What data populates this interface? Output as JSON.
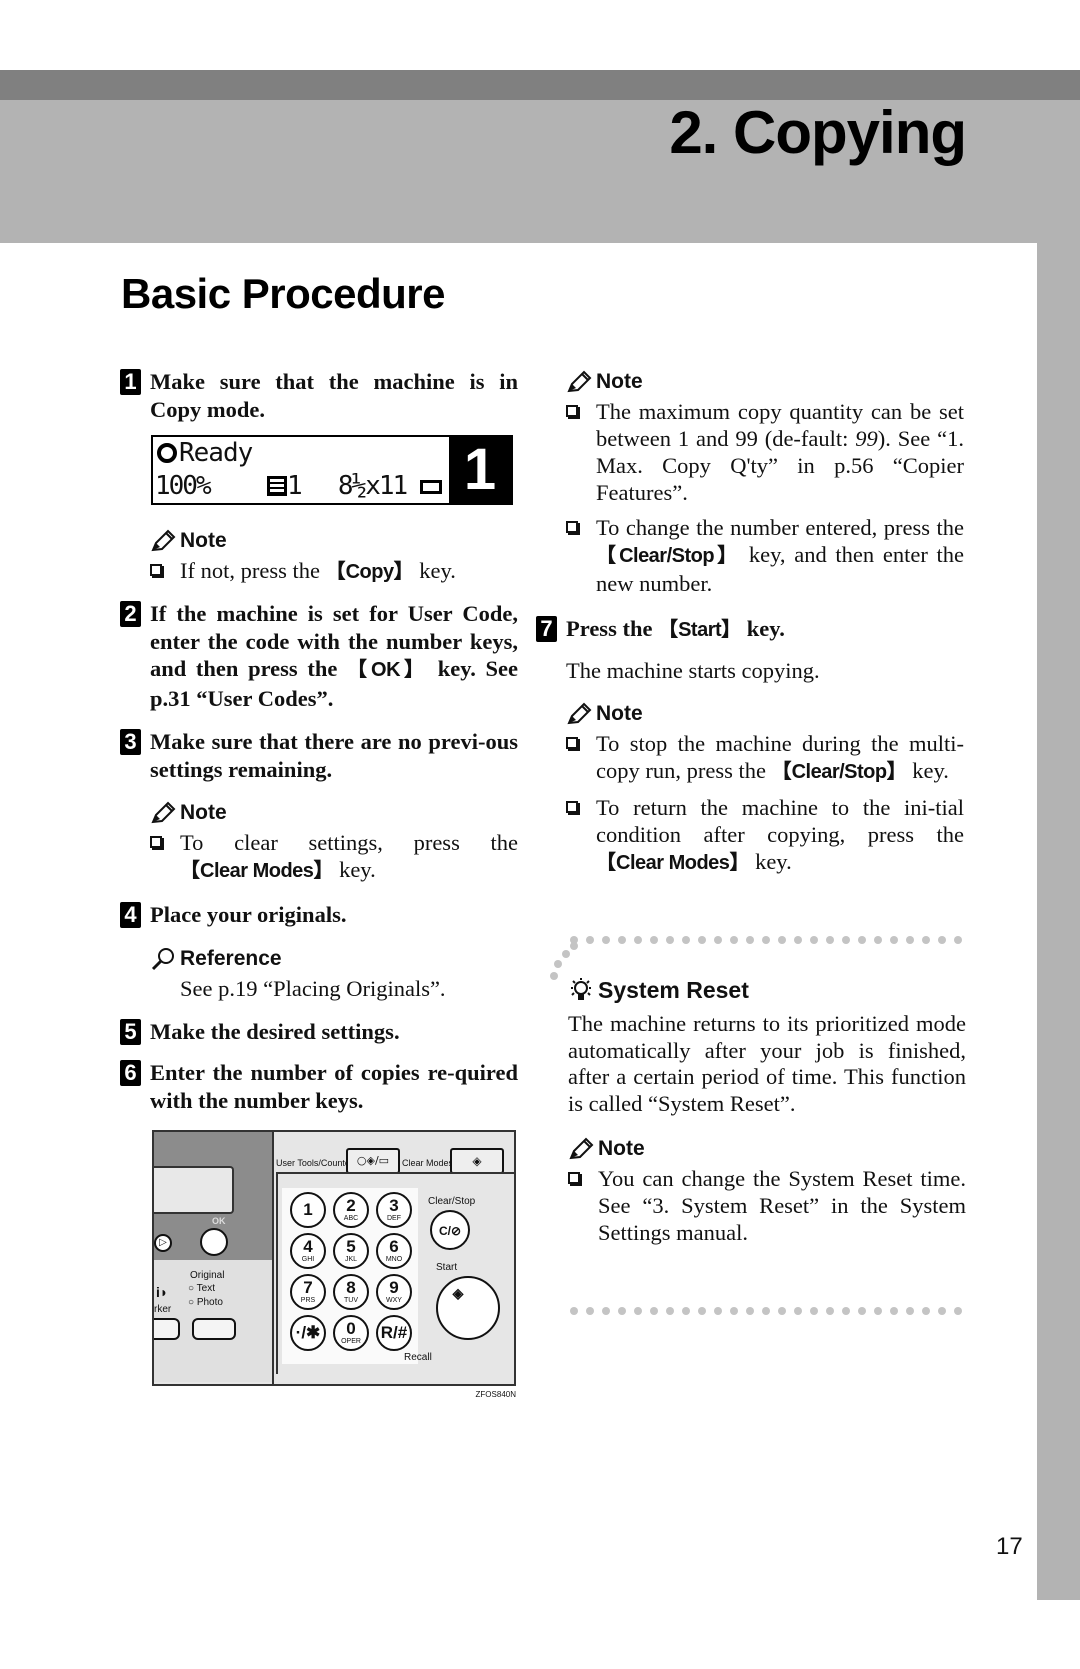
{
  "header": {
    "chapter_title": "2. Copying"
  },
  "page": {
    "title": "Basic Procedure",
    "page_number": "17"
  },
  "icons": {
    "note": "pencil-icon",
    "reference": "magnifier-icon",
    "tip": "lightbulb-icon",
    "bullet": "checkbox-square-icon"
  },
  "steps": [
    {
      "num": "1",
      "text": "Make sure that the machine is in Copy mode.",
      "lcd": {
        "line1": "Ready",
        "line2_ratio": "100%",
        "line2_tray": "1",
        "line2_size": "8½x11",
        "count": "1"
      },
      "note_label": "Note",
      "notes": [
        {
          "pre": "If not, press the ",
          "key": "Copy",
          "post": " key."
        }
      ]
    },
    {
      "num": "2",
      "text_pre": "If the machine is set for User Code, enter the code with the number keys, and then press the ",
      "key": "OK",
      "text_post": " key. See p.31 “User Codes”."
    },
    {
      "num": "3",
      "text": "Make sure that there are no previ-ous settings remaining.",
      "note_label": "Note",
      "notes": [
        {
          "pre": "To clear settings, press the ",
          "key": "Clear Modes",
          "post": " key."
        }
      ]
    },
    {
      "num": "4",
      "text": "Place your originals.",
      "reference_label": "Reference",
      "reference_text": "See p.19 “Placing Originals”."
    },
    {
      "num": "5",
      "text": "Make the desired settings."
    },
    {
      "num": "6",
      "text": "Enter the number of copies re-quired with the number keys.",
      "panel": {
        "user_tools_label": "User Tools/Counter",
        "clear_modes_label": "Clear Modes",
        "ok_label": "OK",
        "original_label": "Original",
        "text_option": "Text",
        "photo_option": "Photo",
        "marker_label": "rker",
        "clear_stop_label": "Clear/Stop",
        "clear_stop_glyph": "C/⊘",
        "start_label": "Start",
        "recall_label": "Recall",
        "figure_code": "ZFOS840N",
        "keys": [
          {
            "n": "1",
            "s": ""
          },
          {
            "n": "2",
            "s": "ABC"
          },
          {
            "n": "3",
            "s": "DEF"
          },
          {
            "n": "4",
            "s": "GHI"
          },
          {
            "n": "5",
            "s": "JKL"
          },
          {
            "n": "6",
            "s": "MNO"
          },
          {
            "n": "7",
            "s": "PRS"
          },
          {
            "n": "8",
            "s": "TUV"
          },
          {
            "n": "9",
            "s": "WXY"
          },
          {
            "n": "·/✱",
            "s": ""
          },
          {
            "n": "0",
            "s": "OPER"
          },
          {
            "n": "R/#",
            "s": ""
          }
        ]
      },
      "note_label": "Note",
      "notes": [
        {
          "pre": "The maximum copy quantity can be set between 1 and 99 (de-fault: ",
          "italic": "99",
          "post": "). See “1. Max. Copy Q'ty” in p.56 “Copier Features”."
        },
        {
          "pre": "To change the number entered, press the ",
          "key": "Clear/Stop",
          "post": " key, and then enter the new number."
        }
      ]
    },
    {
      "num": "7",
      "text_pre": "Press the ",
      "key": "Start",
      "text_post": " key.",
      "body": "The machine starts copying.",
      "note_label": "Note",
      "notes": [
        {
          "pre": "To stop the machine during the multi-copy run, press the ",
          "key": "Clear/Stop",
          "post": " key."
        },
        {
          "pre": "To return the machine to the ini-tial condition after copying, press the ",
          "key": "Clear Modes",
          "post": " key."
        }
      ]
    }
  ],
  "tip": {
    "title": "System Reset",
    "body": "The machine returns to its prioritized mode automatically after your job is finished, after a certain period of time. This function is called “System Reset”.",
    "note_label": "Note",
    "notes": [
      {
        "pre": "You can change the System Reset time. See “3. System Reset” in the System Settings manual."
      }
    ]
  },
  "colors": {
    "header_dark": "#808080",
    "header_light": "#b3b3b3",
    "dots": "#c4c4c4",
    "text": "#111111"
  }
}
